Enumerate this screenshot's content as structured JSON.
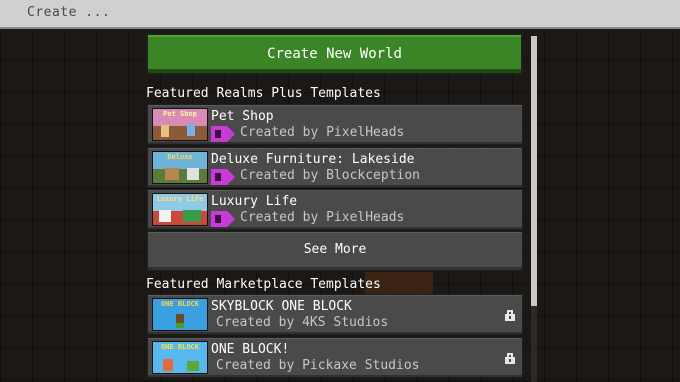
{
  "topbar": {
    "title": "Create ..."
  },
  "create_button": {
    "label": "Create New World"
  },
  "realms": {
    "heading": "Featured Realms Plus Templates",
    "items": [
      {
        "title": "Pet Shop",
        "subtitle": "Created by PixelHeads",
        "thumb_label": "Pet Shop",
        "thumb_icon": "pet-shop-thumbnail-icon"
      },
      {
        "title": "Deluxe Furniture: Lakeside",
        "subtitle": "Created by Blockception",
        "thumb_label": "Deluxe",
        "thumb_icon": "lakeside-thumbnail-icon"
      },
      {
        "title": "Luxury Life",
        "subtitle": "Created by PixelHeads",
        "thumb_label": "Luxury Life",
        "thumb_icon": "luxury-life-thumbnail-icon"
      }
    ],
    "see_more": "See More"
  },
  "marketplace": {
    "heading": "Featured Marketplace Templates",
    "items": [
      {
        "title": "SKYBLOCK ONE BLOCK",
        "subtitle": "Created by 4KS Studios",
        "thumb_label": "ONE BLOCK",
        "locked": true
      },
      {
        "title": "ONE BLOCK!",
        "subtitle": "Created by Pickaxe Studios",
        "thumb_label": "ONE BLOCK",
        "locked": true
      }
    ]
  },
  "colors": {
    "create_green": "#3c8527",
    "tile_gray": "#4a4a4a",
    "realms_badge": "#c93bd9",
    "subtitle_gray": "#c6c6c6"
  }
}
